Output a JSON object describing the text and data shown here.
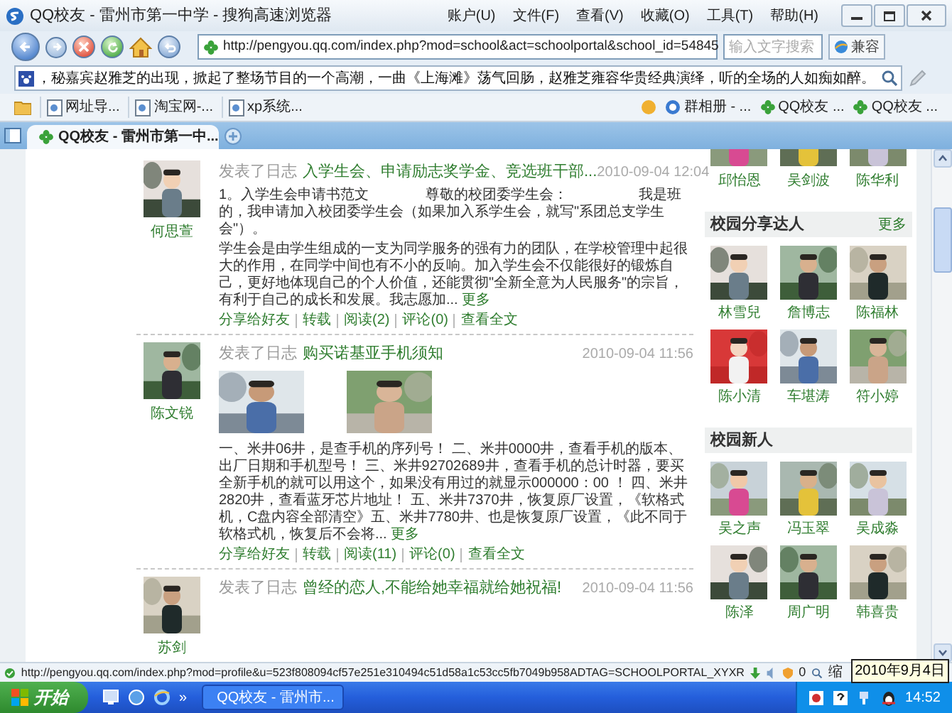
{
  "window": {
    "title": "QQ校友 - 雷州市第一中学 - 搜狗高速浏览器",
    "menu": [
      "账户(U)",
      "文件(F)",
      "查看(V)",
      "收藏(O)",
      "工具(T)",
      "帮助(H)"
    ]
  },
  "nav": {
    "url": "http://pengyou.qq.com/index.php?mod=school&act=schoolportal&school_id=54845",
    "search_placeholder": "输入文字搜索",
    "compat_button": "兼容"
  },
  "ticker": {
    "text": "，秘嘉宾赵雅芝的出现，掀起了整场节目的一个高潮，一曲《上海滩》荡气回肠，赵雅芝雍容华贵经典演绎，听的全场的人如痴如醉。"
  },
  "bookmarks": {
    "left": [
      "网址导...",
      "淘宝网-...",
      "xp系统..."
    ],
    "right": [
      {
        "kind": "album",
        "label": "群相册 - ..."
      },
      {
        "kind": "clover",
        "label": "QQ校友 ..."
      },
      {
        "kind": "clover",
        "label": "QQ校友 ..."
      }
    ]
  },
  "tabs": [
    {
      "label": "QQ校友 - 雷州市第一中...",
      "selected": true
    }
  ],
  "posts": [
    {
      "author": "何思萱",
      "prefix": "发表了日志",
      "title": "入学生会、申请励志奖学金、竞选班干部...",
      "date": "2010-09-04 12:04",
      "body": [
        "1。入学生会申请书范文　　　　尊敬的校团委学生会：　　　　　我是班的，我申请加入校团委学生会（如果加入系学生会，就写\"系团总支学生会\"）。",
        "学生会是由学生组成的一支为同学服务的强有力的团队，在学校管理中起很大的作用，在同学中间也有不小的反响。加入学生会不仅能很好的锻炼自己，更好地体现自己的个人价值，还能贯彻\"全新全意为人民服务\"的宗旨，有利于自己的成长和发展。我志愿加..."
      ],
      "more": "更多",
      "actions": [
        "分享给好友",
        "转载",
        "阅读(2)",
        "评论(0)",
        "查看全文"
      ]
    },
    {
      "author": "陈文锐",
      "prefix": "发表了日志",
      "title": "购买诺基亚手机须知",
      "date": "2010-09-04 11:56",
      "photos": [
        {
          "kind": "picture"
        },
        {
          "kind": "picture"
        }
      ],
      "body": [
        "一、米井06井，是查手机的序列号！ 二、米井0000井，查看手机的版本、出厂日期和手机型号！ 三、米井92702689井，查看手机的总计时器，要买全新手机的就可以用这个，如果没有用过的就显示000000：00 ！ 四、米井2820井，查看蓝牙芯片地址！ 五、米井7370井，恢复原厂设置，《软格式机，C盘内容全部清空》五、米井7780井、也是恢复原厂设置，《此不同于软格式机，恢复后不会将..."
      ],
      "more": "更多",
      "actions": [
        "分享给好友",
        "转载",
        "阅读(11)",
        "评论(0)",
        "查看全文"
      ]
    },
    {
      "author": "苏剑",
      "prefix": "发表了日志",
      "title": "曾经的恋人,不能给她幸福就给她祝福!",
      "date": "2010-09-04 11:56"
    }
  ],
  "sidebar": {
    "top_people": [
      "邱怡恩",
      "吴剑波",
      "陈华利"
    ],
    "sections": [
      {
        "title": "校园分享达人",
        "more": "更多",
        "people": [
          "林雪兒",
          "詹博志",
          "陈福林",
          "陈小清",
          "车堪涛",
          "符小婷"
        ]
      },
      {
        "title": "校园新人",
        "people": [
          "吴之声",
          "冯玉翠",
          "吴成淼",
          "陈泽",
          "周广明",
          "韩喜贵"
        ]
      }
    ]
  },
  "status_bar": {
    "url": "http://pengyou.qq.com/index.php?mod=profile&u=523f808094cf57e251e310494c51d58a1c53cc5fb7049b958ADTAG=SCHOOLPORTAL_XYXR",
    "count": "0",
    "zoom": "缩",
    "tooltip": "2010年9月4日"
  },
  "taskbar": {
    "start": "开始",
    "chevron": "»",
    "task": "QQ校友 - 雷州市...",
    "clock": "14:52"
  }
}
